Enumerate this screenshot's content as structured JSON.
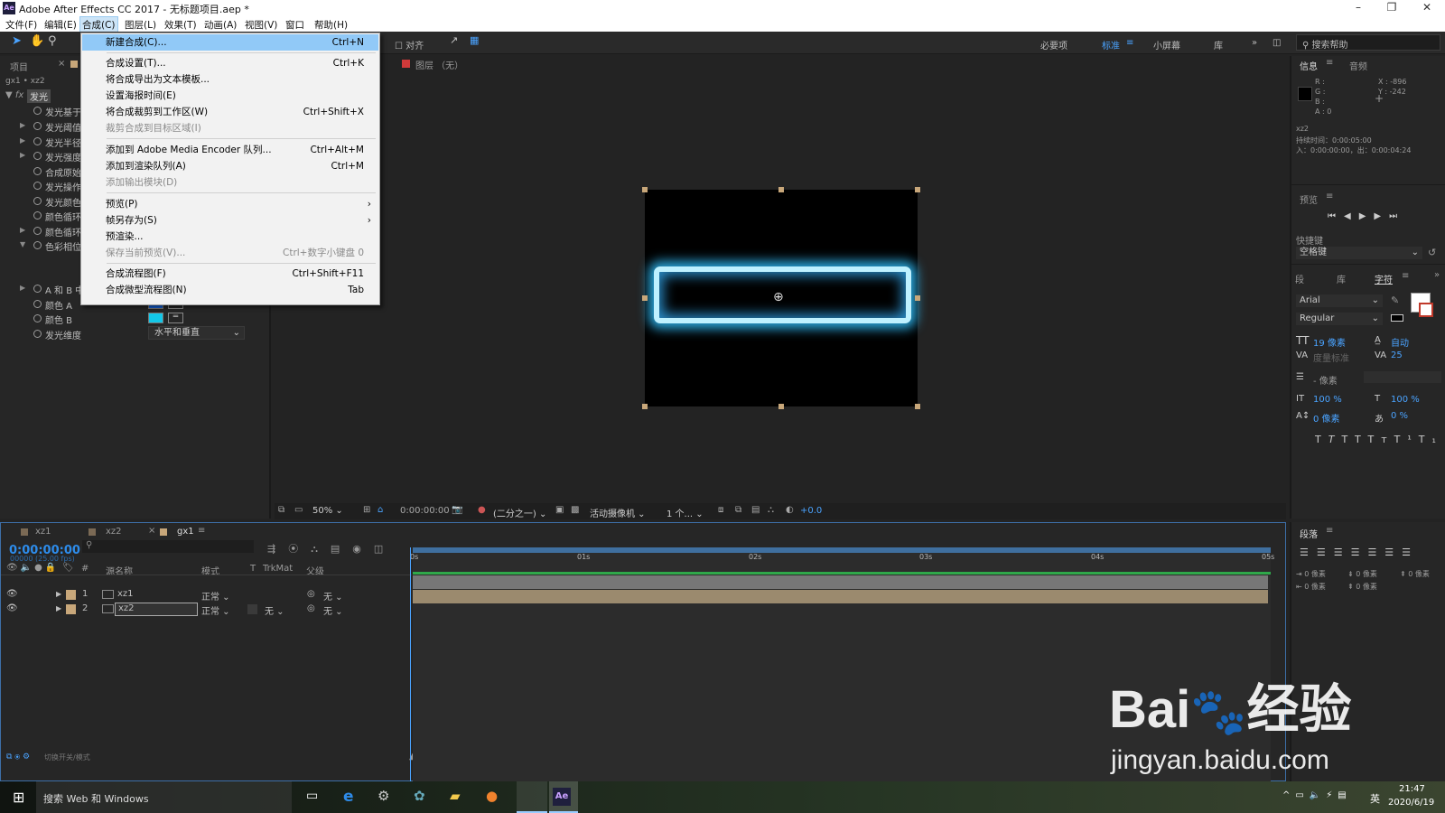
{
  "app": {
    "title": "Adobe After Effects CC 2017 - 无标题项目.aep *",
    "icon": "Ae"
  },
  "menubar": [
    "文件(F)",
    "编辑(E)",
    "合成(C)",
    "图层(L)",
    "效果(T)",
    "动画(A)",
    "视图(V)",
    "窗口",
    "帮助(H)"
  ],
  "toolbar": {
    "align": "对齐",
    "workspaces": [
      "必要项",
      "标准",
      "小屏幕",
      "库"
    ],
    "search_placeholder": "搜索帮助"
  },
  "composition_menu": [
    {
      "label": "新建合成(C)...",
      "shortcut": "Ctrl+N",
      "state": "highlight"
    },
    {
      "label": "合成设置(T)...",
      "shortcut": "Ctrl+K"
    },
    {
      "label": "将合成导出为文本模板...",
      "shortcut": ""
    },
    {
      "label": "设置海报时间(E)",
      "shortcut": ""
    },
    {
      "label": "将合成裁剪到工作区(W)",
      "shortcut": "Ctrl+Shift+X"
    },
    {
      "label": "裁剪合成到目标区域(I)",
      "shortcut": "",
      "state": "disabled"
    },
    {
      "label": "添加到 Adobe Media Encoder 队列...",
      "shortcut": "Ctrl+Alt+M"
    },
    {
      "label": "添加到渲染队列(A)",
      "shortcut": "Ctrl+M"
    },
    {
      "label": "添加输出模块(D)",
      "shortcut": "",
      "state": "disabled"
    },
    {
      "label": "预览(P)",
      "shortcut": "",
      "submenu": true
    },
    {
      "label": "帧另存为(S)",
      "shortcut": "",
      "submenu": true
    },
    {
      "label": "预渲染...",
      "shortcut": ""
    },
    {
      "label": "保存当前预览(V)...",
      "shortcut": "Ctrl+数字小键盘 0",
      "state": "disabled"
    },
    {
      "label": "合成流程图(F)",
      "shortcut": "Ctrl+Shift+F11"
    },
    {
      "label": "合成微型流程图(N)",
      "shortcut": "Tab"
    }
  ],
  "left_panel": {
    "tabs": [
      "项目"
    ],
    "comp_path": "gx1 • xz2",
    "effect_name": "发光",
    "props": [
      "发光基于",
      "发光阈值",
      "发光半径",
      "发光强度",
      "合成原始项目",
      "发光操作",
      "发光颜色",
      "颜色循环",
      "颜色循环",
      "色彩相位",
      "A 和 B 中点",
      "颜色 A",
      "颜色 B",
      "发光维度"
    ],
    "glow_dimension_value": "水平和垂直",
    "color_a": "#1565e0",
    "color_b": "#13c7e8"
  },
  "viewer": {
    "layer_label": "图层 （无）",
    "zoom": "50%",
    "timecode": "0:00:00:00",
    "resolution": "(二分之一)",
    "camera": "活动摄像机",
    "views": "1 个...",
    "exposure": "+0.0"
  },
  "info_panel": {
    "tabs": [
      "信息",
      "音频"
    ],
    "rgba": [
      "R :",
      "G :",
      "B :",
      "A : 0"
    ],
    "x": "X : -896",
    "y": "Y : -242",
    "layer": "xz2",
    "duration": "持续时间：0:00:05:00",
    "in_out": "入：0:00:00:00，出：0:00:04:24"
  },
  "preview_panel": {
    "title": "预览",
    "shortcut_label": "快捷键",
    "shortcut_value": "空格键"
  },
  "character_panel": {
    "tabs": [
      "段",
      "库",
      "字符"
    ],
    "font": "Arial",
    "style": "Regular",
    "size": "19 像素",
    "leading": "自动",
    "kerning": "度量标准",
    "tracking": "25",
    "stroke": "- 像素",
    "vscale": "100 %",
    "hscale": "100 %",
    "baseline": "0 像素",
    "tsume": "0 %"
  },
  "timeline": {
    "tabs": [
      "xz1",
      "xz2",
      "gx1"
    ],
    "timecode": "0:00:00:00",
    "fps": "00000 (25.00 fps)",
    "columns": [
      "#",
      "源名称",
      "模式",
      "T",
      "TrkMat",
      "父级"
    ],
    "layers": [
      {
        "num": "1",
        "name": "xz1",
        "mode": "正常",
        "trkmat": "",
        "parent": "无"
      },
      {
        "num": "2",
        "name": "xz2",
        "mode": "正常",
        "trkmat": "无",
        "parent": "无"
      }
    ],
    "ruler": [
      "0s",
      "01s",
      "02s",
      "03s",
      "04s",
      "05s"
    ],
    "footer": "切换开关/模式"
  },
  "paragraph_panel": {
    "title": "段落",
    "vals": [
      "0 像素",
      "0 像素",
      "0 像素",
      "0 像素",
      "0 像素"
    ]
  },
  "taskbar": {
    "search": "搜索 Web 和 Windows",
    "time": "21:47",
    "date": "2020/6/19",
    "lang": "英"
  },
  "watermark": {
    "brand": "Bai",
    "brand2": "经验",
    "url": "jingyan.baidu.com"
  }
}
